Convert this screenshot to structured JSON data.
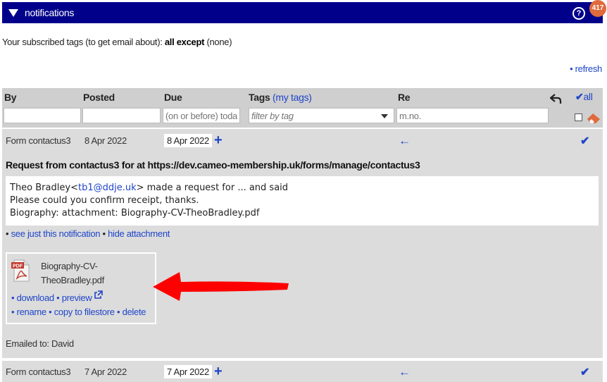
{
  "topbar": {
    "title": "notifications",
    "help": "?",
    "badge": "417"
  },
  "subscriptions": {
    "prefix": "Your subscribed tags (to get email about): ",
    "mode": "all except",
    "suffix": " (none)"
  },
  "refresh": "• refresh",
  "columns": {
    "by": "By",
    "posted": "Posted",
    "due": "Due",
    "tags": "Tags",
    "my_tags": "(my tags)",
    "re": "Re",
    "all": "all"
  },
  "filters": {
    "due_placeholder": "(on or before) today",
    "tags_placeholder": "filter by tag",
    "re_placeholder": "m.no."
  },
  "notification": {
    "by": "Form contactus3",
    "posted": "8 Apr 2022",
    "due": "8 Apr 2022",
    "title": "Request from contactus3 for at https://dev.cameo-membership.uk/forms/manage/contactus3",
    "message": {
      "sender": "Theo Bradley",
      "email": "tb1@ddje.uk",
      "line1_rest": " made a request for ... and said",
      "line2": "Please could you confirm receipt, thanks.",
      "line3": "Biography: attachment: Biography-CV-TheoBradley.pdf"
    },
    "links": {
      "see_just": "see just this notification",
      "hide_attachment": "hide attachment"
    },
    "attachment": {
      "name_line1": "Biography-CV-",
      "name_line2": "TheoBradley.pdf",
      "download": "download",
      "preview": "preview",
      "rename": "rename",
      "copy": "copy to filestore",
      "delete": "delete"
    },
    "emailed": "Emailed to: David"
  },
  "notification2": {
    "by": "Form contactus3",
    "posted": "7 Apr 2022",
    "due": "7 Apr 2022"
  },
  "colors": {
    "topbar": "#00008b",
    "link": "#1f45c9",
    "badge": "#e06a3c",
    "arrow": "#ff0000"
  }
}
